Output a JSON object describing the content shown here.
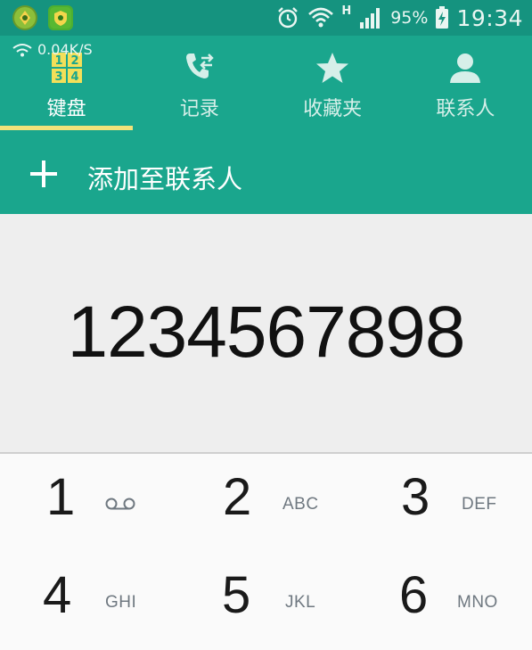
{
  "status_bar": {
    "network_type": "H",
    "battery_percent": "95%",
    "time": "19:34",
    "net_speed": "0.04K/S",
    "app_icons": [
      "green-app-icon",
      "green-shield-app-icon"
    ]
  },
  "tabs": [
    {
      "label": "键盘",
      "icon": "keypad-icon",
      "active": true
    },
    {
      "label": "记录",
      "icon": "call-log-icon",
      "active": false
    },
    {
      "label": "收藏夹",
      "icon": "star-icon",
      "active": false
    },
    {
      "label": "联系人",
      "icon": "person-icon",
      "active": false
    }
  ],
  "keypad_icon_digits": [
    "1",
    "2",
    "3",
    "4"
  ],
  "add_contact": {
    "label": "添加至联系人",
    "icon": "plus-icon"
  },
  "dialed_number": "1234567898",
  "keys": [
    {
      "digit": "1",
      "letters": "",
      "icon": "voicemail-icon"
    },
    {
      "digit": "2",
      "letters": "ABC"
    },
    {
      "digit": "3",
      "letters": "DEF"
    },
    {
      "digit": "4",
      "letters": "GHI"
    },
    {
      "digit": "5",
      "letters": "JKL"
    },
    {
      "digit": "6",
      "letters": "MNO"
    }
  ],
  "colors": {
    "status_bar": "#15937f",
    "header": "#1aa68d",
    "tab_indicator": "#f2e27a",
    "display_bg": "#eeeeee",
    "keypad_bg": "#fafafa"
  }
}
